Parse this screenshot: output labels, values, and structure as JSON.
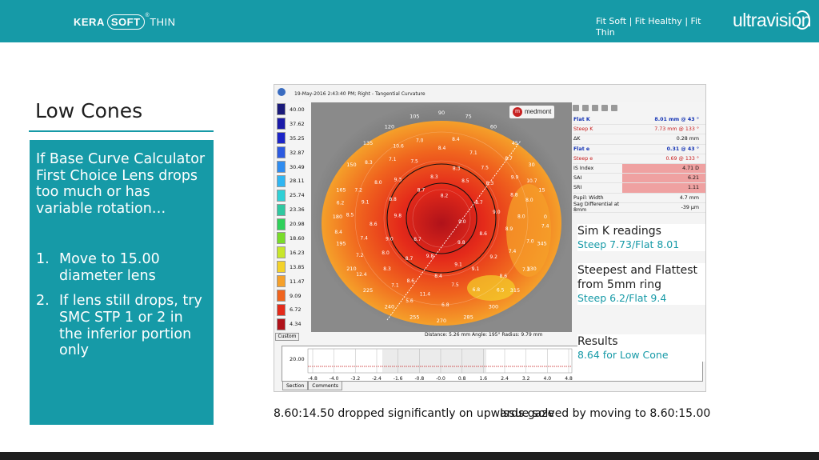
{
  "header": {
    "logo_left": "KERA",
    "logo_middle": "SOFT",
    "logo_right": "THIN",
    "logo_reg": "®",
    "tagline": "Fit Soft | Fit Healthy | Fit Thin",
    "brand": "ultravision",
    "bg_color": "#169aa7"
  },
  "title": "Low Cones",
  "panel": {
    "intro": "If Base Curve Calculator First Choice Lens drops too much or has variable rotation…",
    "items": [
      {
        "num": "1.",
        "text": "Move to 15.00 diameter lens"
      },
      {
        "num": "2.",
        "text": "If lens still drops, try SMC STP 1 or 2 in the inferior portion only"
      }
    ]
  },
  "topography": {
    "header_text": "19-May-2016 2:43:40 PM; Right - Tangential Curvature",
    "brand": "medmont",
    "scale": [
      {
        "value": "40.00",
        "color": "#1a1a7a"
      },
      {
        "value": "37.62",
        "color": "#1a1aa8"
      },
      {
        "value": "35.25",
        "color": "#1c24c8"
      },
      {
        "value": "32.87",
        "color": "#2c5ae0"
      },
      {
        "value": "30.49",
        "color": "#2f8cf0"
      },
      {
        "value": "28.11",
        "color": "#2fb6f2"
      },
      {
        "value": "25.74",
        "color": "#2fd0d6"
      },
      {
        "value": "23.36",
        "color": "#2fc8a0"
      },
      {
        "value": "20.98",
        "color": "#2fd05a"
      },
      {
        "value": "18.60",
        "color": "#78dc2a"
      },
      {
        "value": "16.23",
        "color": "#c8e62a"
      },
      {
        "value": "13.85",
        "color": "#f3d22a"
      },
      {
        "value": "11.47",
        "color": "#f5a02a"
      },
      {
        "value": "9.09",
        "color": "#f0641e"
      },
      {
        "value": "6.72",
        "color": "#e42a1a"
      },
      {
        "value": "4.34",
        "color": "#b0121a"
      }
    ],
    "custom_label": "Custom",
    "map_footer": "Distance: 5.26 mm   Angle: 195°   Radius: 9.79 mm",
    "metrics": [
      {
        "label": "Flat K",
        "value": "8.01 mm @  43 °",
        "style": "blue"
      },
      {
        "label": "Steep K",
        "value": "7.73 mm @ 133 °",
        "style": "red"
      },
      {
        "label": "ΔK",
        "value": "0.28 mm",
        "style": ""
      },
      {
        "label": "Flat e",
        "value": "0.31 @  43 °",
        "style": "blue"
      },
      {
        "label": "Steep e",
        "value": "0.69 @ 133 °",
        "style": "red"
      },
      {
        "label": "IS Index",
        "value": "4.71 D",
        "style": "pink"
      },
      {
        "label": "SAI",
        "value": "6.21",
        "style": "pink"
      },
      {
        "label": "SRI",
        "value": "1.11",
        "style": "pink"
      },
      {
        "label": "Pupil: Width",
        "value": "4.7 mm",
        "style": ""
      },
      {
        "label": "Sag Differential at 8mm",
        "value": "-39 μm",
        "style": ""
      }
    ],
    "section_ylabel": "20.00",
    "section_ticks": [
      "-4.8",
      "-4.0",
      "-3.2",
      "-2.4",
      "-1.6",
      "-0.8",
      "-0.0",
      "0.8",
      "1.6",
      "2.4",
      "3.2",
      "4.0",
      "4.8"
    ],
    "tabs": [
      "Section",
      "Comments"
    ],
    "angle_labels": [
      {
        "t": "90",
        "a": 90
      },
      {
        "t": "105",
        "a": 105
      },
      {
        "t": "75",
        "a": 75
      },
      {
        "t": "120",
        "a": 120
      },
      {
        "t": "60",
        "a": 60
      },
      {
        "t": "135",
        "a": 135
      },
      {
        "t": "45",
        "a": 45
      },
      {
        "t": "150",
        "a": 150
      },
      {
        "t": "30",
        "a": 30
      },
      {
        "t": "165",
        "a": 165
      },
      {
        "t": "15",
        "a": 15
      },
      {
        "t": "180",
        "a": 180
      },
      {
        "t": "0",
        "a": 0
      },
      {
        "t": "195",
        "a": 195
      },
      {
        "t": "345",
        "a": 345
      },
      {
        "t": "210",
        "a": 210
      },
      {
        "t": "330",
        "a": 330
      },
      {
        "t": "225",
        "a": 225
      },
      {
        "t": "315",
        "a": 315
      },
      {
        "t": "240",
        "a": 240
      },
      {
        "t": "300",
        "a": 300
      },
      {
        "t": "255",
        "a": 255
      },
      {
        "t": "285",
        "a": 285
      },
      {
        "t": "270",
        "a": 270
      }
    ],
    "curvature_values": [
      "9.0",
      "8.7",
      "8.2",
      "9.8",
      "9.8",
      "8.7",
      "9.8",
      "8.7",
      "8.6",
      "9.0",
      "8.5",
      "9.1",
      "8.8",
      "9.0",
      "8.7",
      "8.3",
      "9.2",
      "8.6",
      "8.3",
      "8.4",
      "9.3",
      "8.9",
      "8.0",
      "8.3",
      "9.1",
      "9.1",
      "8.8",
      "8.6",
      "7.5",
      "7.4",
      "7.4",
      "7.5",
      "7.5",
      "8.0",
      "8.0",
      "8.3",
      "8.4",
      "8.6",
      "8.5",
      "9.9",
      "11.4",
      "7.1",
      "7.0",
      "7.2",
      "7.1",
      "6.8",
      "7.2",
      "8.0",
      "7.1",
      "7.0",
      "7.3",
      "8.4",
      "8.7",
      "6.8",
      "8.3",
      "7.4",
      "12.4",
      "8.4",
      "6.5",
      "6.2",
      "10.7",
      "5.6",
      "10.6"
    ]
  },
  "notes": [
    {
      "main": "Sim K readings",
      "sub": "Steep 7.73/Flat 8.01"
    },
    {
      "main": "Steepest and Flattest from 5mm ring",
      "sub": "Steep 6.2/Flat 9.4"
    },
    {
      "main": "Results",
      "sub": "8.64 for Low Cone"
    }
  ],
  "captions": {
    "left": "8.60:14.50 dropped significantly on upwards gaze",
    "right": "Issue solved by moving to 8.60:15.00"
  }
}
